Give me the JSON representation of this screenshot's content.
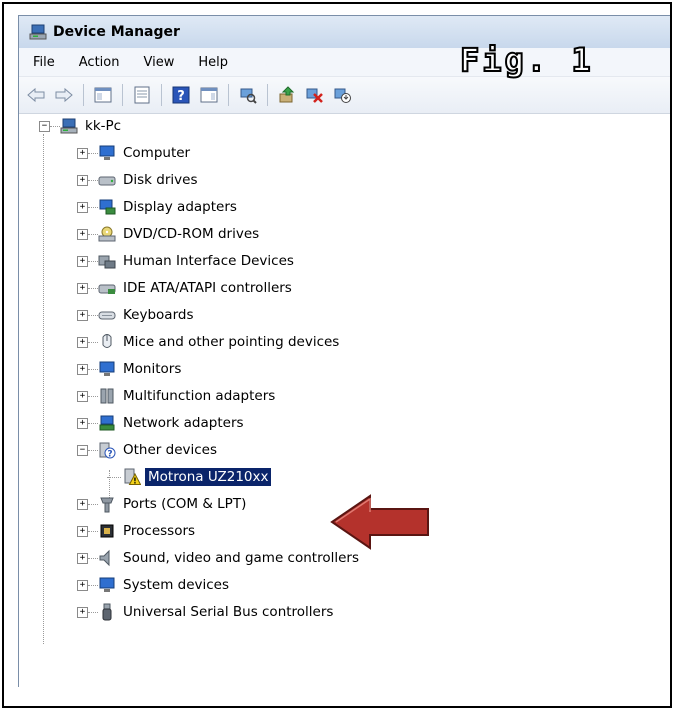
{
  "window": {
    "title": "Device Manager"
  },
  "menu": [
    "File",
    "Action",
    "View",
    "Help"
  ],
  "figure_label": "Fig. 1",
  "toolbar": [
    "back-icon",
    "forward-icon",
    "show-hide-tree-icon",
    "properties-icon",
    "help-icon",
    "show-action-pane-icon",
    "scan-hardware-icon",
    "update-driver-icon",
    "uninstall-icon",
    "disable-icon"
  ],
  "tree": {
    "root": "kk-Pc",
    "items": [
      {
        "label": "Computer",
        "icon": "computer-icon"
      },
      {
        "label": "Disk drives",
        "icon": "disk-drive-icon"
      },
      {
        "label": "Display adapters",
        "icon": "display-adapter-icon"
      },
      {
        "label": "DVD/CD-ROM drives",
        "icon": "dvd-drive-icon"
      },
      {
        "label": "Human Interface Devices",
        "icon": "hid-icon"
      },
      {
        "label": "IDE ATA/ATAPI controllers",
        "icon": "ide-controller-icon"
      },
      {
        "label": "Keyboards",
        "icon": "keyboard-icon"
      },
      {
        "label": "Mice and other pointing devices",
        "icon": "mouse-icon"
      },
      {
        "label": "Monitors",
        "icon": "monitor-icon"
      },
      {
        "label": "Multifunction adapters",
        "icon": "multifunction-icon"
      },
      {
        "label": "Network adapters",
        "icon": "network-adapter-icon"
      },
      {
        "label": "Other devices",
        "icon": "other-devices-icon",
        "expanded": true
      },
      {
        "label": "Motrona UZ210xx",
        "icon": "warning-device-icon",
        "child": true,
        "selected": true
      },
      {
        "label": "Ports (COM & LPT)",
        "icon": "port-icon"
      },
      {
        "label": "Processors",
        "icon": "processor-icon"
      },
      {
        "label": "Sound, video and game controllers",
        "icon": "speaker-icon"
      },
      {
        "label": "System devices",
        "icon": "system-device-icon"
      },
      {
        "label": "Universal Serial Bus controllers",
        "icon": "usb-icon"
      }
    ]
  },
  "colors": {
    "selection": "#0a246a",
    "arrow": "#b4322c",
    "titlebar": "#c8d8ec"
  }
}
